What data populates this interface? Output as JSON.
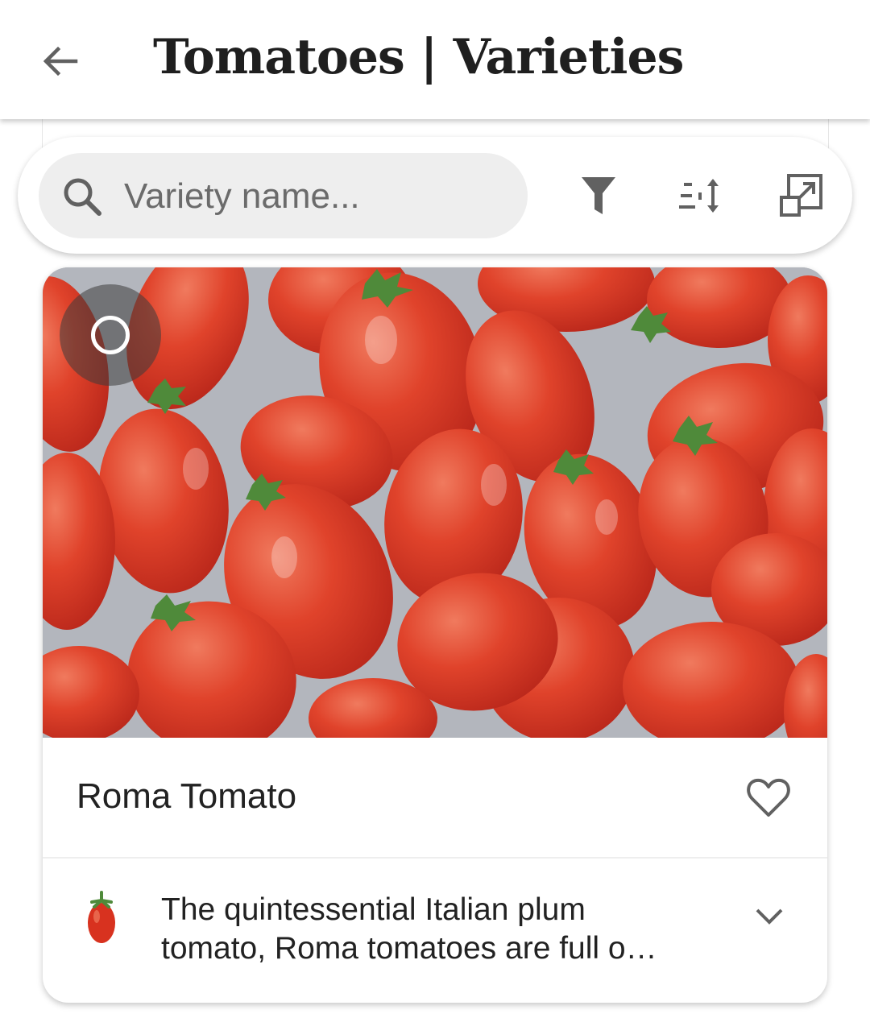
{
  "header": {
    "title": "Tomatoes | Varieties",
    "back_icon": "arrow-left-icon"
  },
  "search": {
    "placeholder": "Variety name...",
    "value": "",
    "icon": "search-icon"
  },
  "toolbar": {
    "filter_icon": "filter-icon",
    "sort_icon": "sort-icon",
    "expand_icon": "expand-view-icon"
  },
  "variety_card": {
    "name": "Roma Tomato",
    "description": "The quintessential Italian plum tomato, Roma tomatoes are full o…",
    "selected": false,
    "favorite": false,
    "image_subject": "pile of red roma tomatoes",
    "thumbnail_icon": "tomato-icon"
  },
  "colors": {
    "tomato_red": "#d8321f",
    "icon_gray": "#616161",
    "search_bg": "#eeeeee"
  }
}
